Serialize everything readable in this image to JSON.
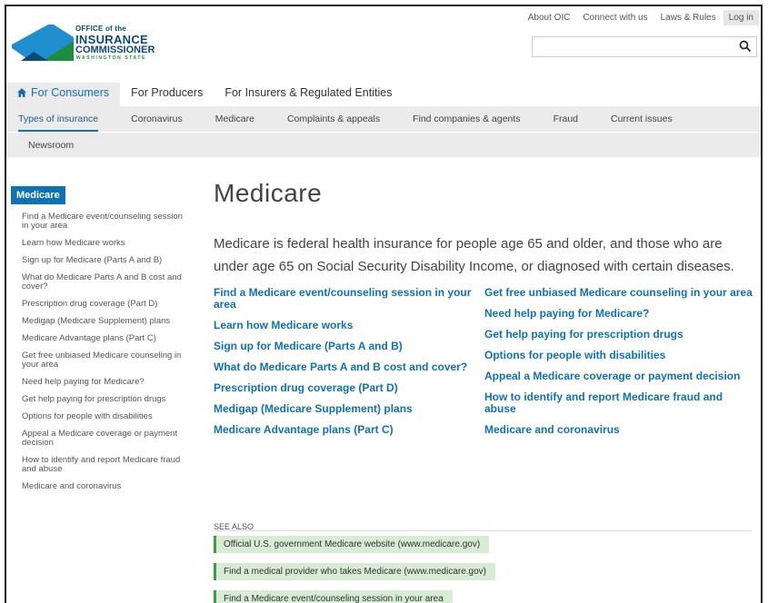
{
  "utility_nav": [
    "About OIC",
    "Connect with us",
    "Laws & Rules",
    "Log in"
  ],
  "logo": {
    "line1": "OFFICE of the",
    "line2": "INSURANCE",
    "line3": "COMMISSIONER",
    "line4": "WASHINGTON STATE"
  },
  "search": {
    "placeholder": "",
    "value": ""
  },
  "audience_tabs": [
    "For Consumers",
    "For Producers",
    "For Insurers & Regulated Entities"
  ],
  "subnav": [
    "Types of insurance",
    "Coronavirus",
    "Medicare",
    "Complaints & appeals",
    "Find companies & agents",
    "Fraud",
    "Current issues"
  ],
  "subnav_row2": "Newsroom",
  "sidebar": {
    "heading": "Medicare",
    "items": [
      "Find a Medicare event/counseling session in your area",
      "Learn how Medicare works",
      "Sign up for Medicare (Parts A and B)",
      "What do Medicare Parts A and B cost and cover?",
      "Prescription drug coverage (Part D)",
      "Medigap (Medicare Supplement) plans",
      "Medicare Advantage plans (Part C)",
      "Get free unbiased Medicare counseling in your area",
      "Need help paying for Medicare?",
      "Get help paying for prescription drugs",
      "Options for people with disabilities",
      "Appeal a Medicare coverage or payment decision",
      "How to identify and report Medicare fraud and abuse",
      "Medicare and coronavirus"
    ]
  },
  "main": {
    "title": "Medicare",
    "lead": "Medicare is federal health insurance for people age 65 and older, and those who are under age 65 on Social Security Disability Income, or diagnosed with certain diseases.",
    "links_left": [
      "Find a Medicare event/counseling session in your area",
      "Learn how Medicare works",
      "Sign up for Medicare (Parts A and B)",
      "What do Medicare Parts A and B cost and cover?",
      "Prescription drug coverage (Part D)",
      "Medigap (Medicare Supplement) plans",
      "Medicare Advantage plans (Part C)"
    ],
    "links_right": [
      "Get free unbiased Medicare counseling in your area",
      "Need help paying for Medicare?",
      "Get help paying for prescription drugs",
      "Options for people with disabilities",
      "Appeal a Medicare coverage or payment decision",
      "How to identify and report Medicare fraud and abuse",
      "Medicare and coronavirus"
    ],
    "see_also_label": "SEE ALSO",
    "see_also": [
      "Official U.S. government Medicare website (www.medicare.gov)",
      "Find a medical provider who takes Medicare (www.medicare.gov)",
      "Find a Medicare event/counseling session in your area"
    ]
  },
  "colors": {
    "accent_blue": "#0e72b6",
    "nav_bg": "#ebebeb",
    "see_also_bg": "#d7ebd5",
    "see_also_border": "#3a9f45",
    "logo_navy": "#0c4a7a",
    "logo_green": "#1a8e3a"
  }
}
